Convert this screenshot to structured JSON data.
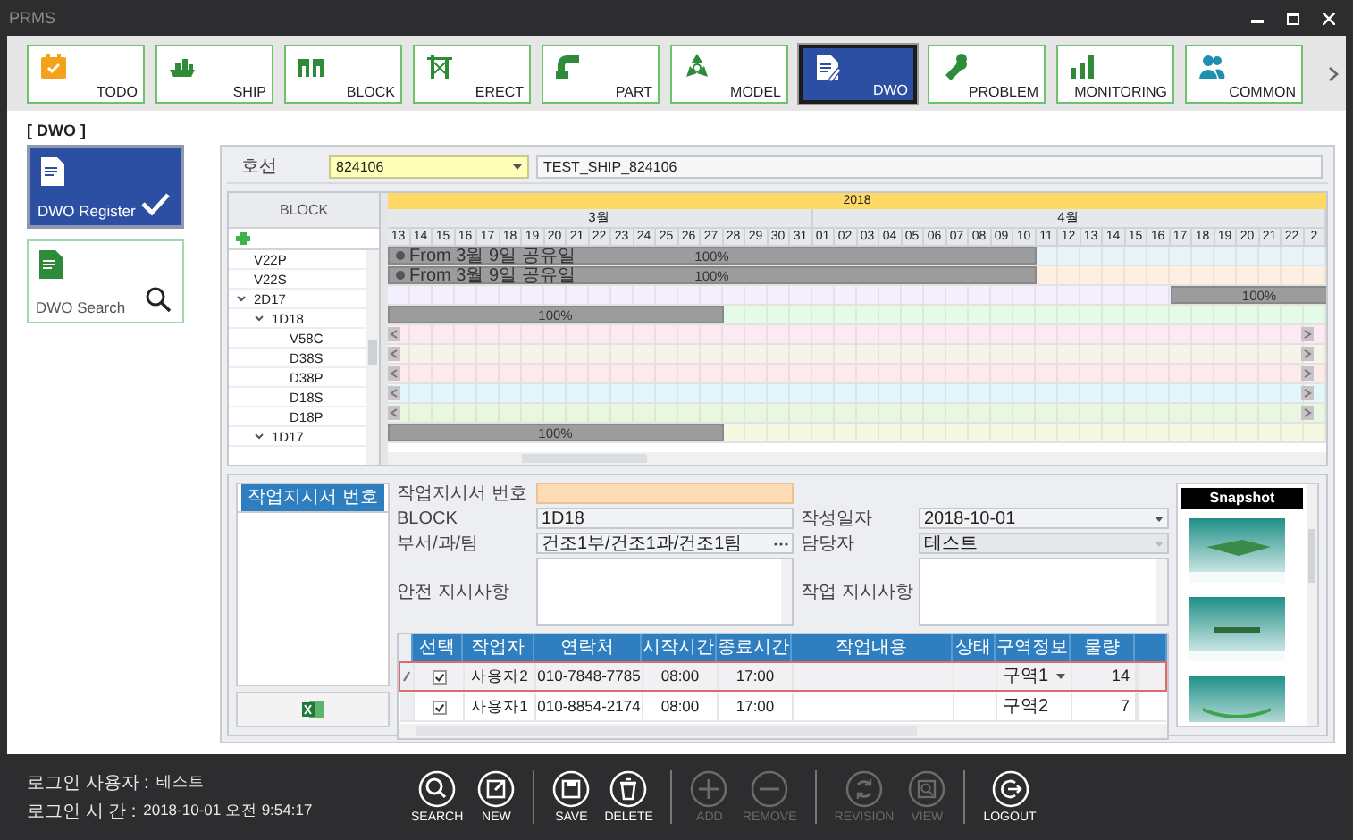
{
  "window": {
    "title": "PRMS"
  },
  "toolbar": [
    {
      "label": "TODO",
      "selected": false
    },
    {
      "label": "SHIP",
      "selected": false
    },
    {
      "label": "BLOCK",
      "selected": false
    },
    {
      "label": "ERECT",
      "selected": false
    },
    {
      "label": "PART",
      "selected": false
    },
    {
      "label": "MODEL",
      "selected": false
    },
    {
      "label": "DWO",
      "selected": true
    },
    {
      "label": "PROBLEM",
      "selected": false
    },
    {
      "label": "MONITORING",
      "selected": false
    },
    {
      "label": "COMMON",
      "selected": false
    }
  ],
  "page_title": "[ DWO ]",
  "modes": [
    {
      "label": "DWO Register",
      "selected": true
    },
    {
      "label": "DWO Search",
      "selected": false
    }
  ],
  "ship": {
    "label": "호선",
    "code": "824106",
    "name": "TEST_SHIP_824106"
  },
  "gantt": {
    "tree_header": "BLOCK",
    "year": "2018",
    "months": [
      {
        "label": "3월",
        "days": [
          "13",
          "14",
          "15",
          "16",
          "17",
          "18",
          "19",
          "20",
          "21",
          "22",
          "23",
          "24",
          "25",
          "26",
          "27",
          "28",
          "29",
          "30",
          "31"
        ]
      },
      {
        "label": "4월",
        "days": [
          "01",
          "02",
          "03",
          "04",
          "05",
          "06",
          "07",
          "08",
          "09",
          "10",
          "11",
          "12",
          "13",
          "14",
          "15",
          "16",
          "17",
          "18",
          "19",
          "20",
          "21",
          "22",
          "2"
        ]
      }
    ],
    "rows": [
      {
        "label": "V22P",
        "color": "#e8f3f7",
        "edge_marks": false,
        "bar": {
          "text": "From 3월 9일 공유일",
          "reading": "100%"
        }
      },
      {
        "label": "V22S",
        "color": "#fdf0e3",
        "edge_marks": false,
        "bar": {
          "text": "From 3월 9일 공유일",
          "reading": "100%"
        }
      },
      {
        "label": "2D17",
        "color": "#f3effc",
        "edge_marks": false,
        "expanded": true,
        "bar": {
          "reading": "100%"
        },
        "children": [
          {
            "label": "1D18",
            "color": "#e4fbe8",
            "edge_marks": false,
            "expanded": true,
            "bar": {
              "reading": "100%"
            },
            "children": [
              {
                "label": "V58C",
                "color": "#fde9f1",
                "edge_marks": true
              },
              {
                "label": "D38S",
                "color": "#f6f4e8",
                "edge_marks": true
              },
              {
                "label": "D38P",
                "color": "#fdeaea",
                "edge_marks": true
              },
              {
                "label": "D18S",
                "color": "#e3f6fa",
                "edge_marks": true
              },
              {
                "label": "D18P",
                "color": "#e9f6e0",
                "edge_marks": true
              }
            ]
          },
          {
            "label": "1D17",
            "color": "#f7f8e1",
            "edge_marks": false,
            "expanded": true,
            "bar": {
              "reading": "100%"
            }
          }
        ]
      }
    ]
  },
  "work_orders": {
    "header": "작업지시서 번호"
  },
  "form": {
    "left": [
      {
        "label": "작업지시서 번호",
        "kind": "highlight",
        "disabled": false
      },
      {
        "label": "BLOCK",
        "kind": "text",
        "value": "1D18",
        "disabled": false
      },
      {
        "label": "부서/과/팀",
        "kind": "picker",
        "value": "건조1부/건조1과/건조1팀",
        "disabled": false
      },
      {
        "label": "안전 지시사항",
        "kind": "memo",
        "disabled": false
      }
    ],
    "right": [
      {
        "label": "작성일자",
        "kind": "dropdown",
        "value": "2018-10-01",
        "disabled": false
      },
      {
        "label": "담당자",
        "kind": "dropdown",
        "value": "테스트",
        "disabled": true
      },
      {
        "label": "작업 지시사항",
        "kind": "memo",
        "disabled": false
      }
    ]
  },
  "table": {
    "columns": [
      "선택",
      "작업자",
      "연락처",
      "시작시간",
      "종료시간",
      "작업내용",
      "상태",
      "구역정보",
      "물량"
    ],
    "rows": [
      {
        "selected": true,
        "checked": true,
        "worker": "사용자2",
        "contact": "010-7848-7785",
        "start_time": "08:00",
        "end_time": "17:00",
        "zone": "구역1",
        "quantity": "14"
      },
      {
        "selected": false,
        "checked": true,
        "worker": "사용자1",
        "contact": "010-8854-2174",
        "start_time": "08:00",
        "end_time": "17:00",
        "zone": "구역2",
        "quantity": "7"
      }
    ]
  },
  "snapshot": {
    "title": "Snapshot"
  },
  "footer": {
    "login": [
      {
        "label": "로그인 사용자 :",
        "value": "테스트"
      },
      {
        "label": "로그인 시  간 :",
        "value": "2018-10-01 오전 9:54:17"
      }
    ],
    "groups": [
      {
        "buttons": [
          {
            "label": "SEARCH",
            "disabled": false
          },
          {
            "label": "NEW",
            "disabled": false
          }
        ]
      },
      {
        "buttons": [
          {
            "label": "SAVE",
            "disabled": false
          },
          {
            "label": "DELETE",
            "disabled": false
          }
        ]
      },
      {
        "buttons": [
          {
            "label": "ADD",
            "disabled": true
          },
          {
            "label": "REMOVE",
            "disabled": true
          }
        ]
      },
      {
        "buttons": [
          {
            "label": "REVISION",
            "disabled": true
          },
          {
            "label": "VIEW",
            "disabled": true
          }
        ]
      },
      {
        "buttons": [
          {
            "label": "LOGOUT",
            "disabled": false
          }
        ]
      }
    ]
  }
}
